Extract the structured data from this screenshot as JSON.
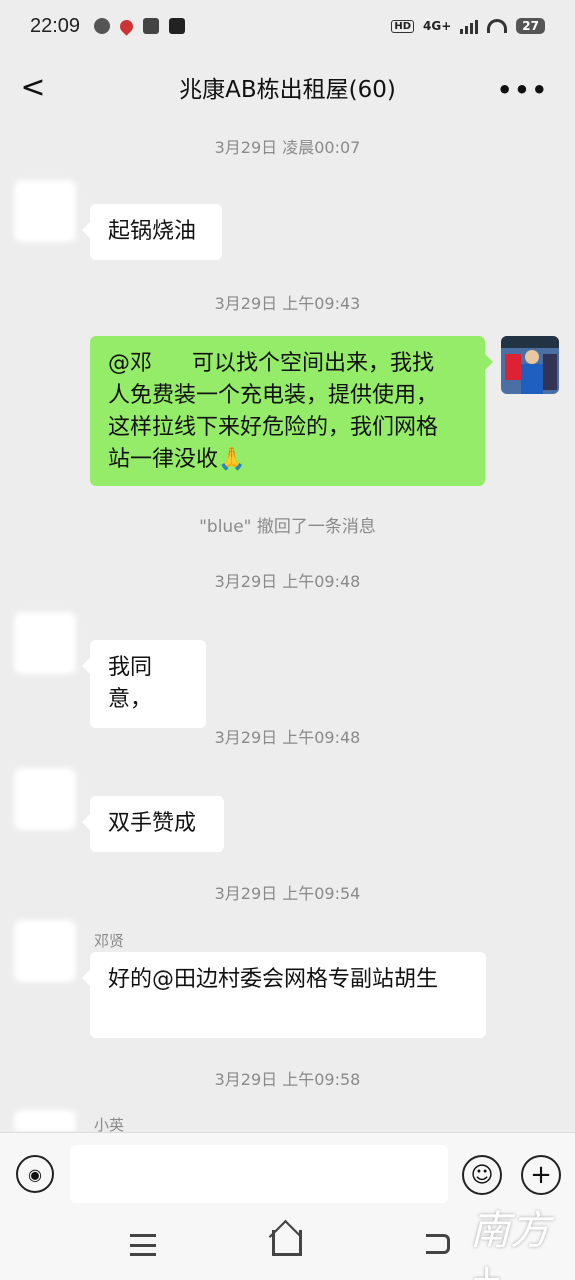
{
  "status_bar": {
    "time": "22:09",
    "network": "4G+",
    "hd": "HD",
    "battery": "27"
  },
  "header": {
    "back_glyph": "<",
    "title": "兆康AB栋出租屋(60)",
    "more_glyph": "•••"
  },
  "messages": {
    "t1": "3月29日 凌晨00:07",
    "m1_sender": "",
    "m1_text": "起锅烧油",
    "t2": "3月29日 上午09:43",
    "m2_text_l1": "@邓",
    "m2_text_l1b": "可以找个空间出来，我找",
    "m2_text_l2": "人免费装一个充电装，提供使用，",
    "m2_text_l3": "这样拉线下来好危险的，我们网格",
    "m2_text_l4": "站一律没收🙏",
    "recall": "\"blue\" 撤回了一条消息",
    "t3": "3月29日 上午09:48",
    "m3_text": "我同意，",
    "t4": "3月29日 上午09:48",
    "m4_text": "双手赞成",
    "t5": "3月29日 上午09:54",
    "m5_sender": "邓贤",
    "m5_text": "好的@田边村委会网格专副站胡生",
    "t6": "3月29日 上午09:58",
    "m6_sender": "小英"
  },
  "input": {
    "placeholder": "",
    "emoji_glyph": "☺",
    "plus_glyph": "+",
    "voice_glyph": "◉"
  },
  "watermark": "南方+"
}
